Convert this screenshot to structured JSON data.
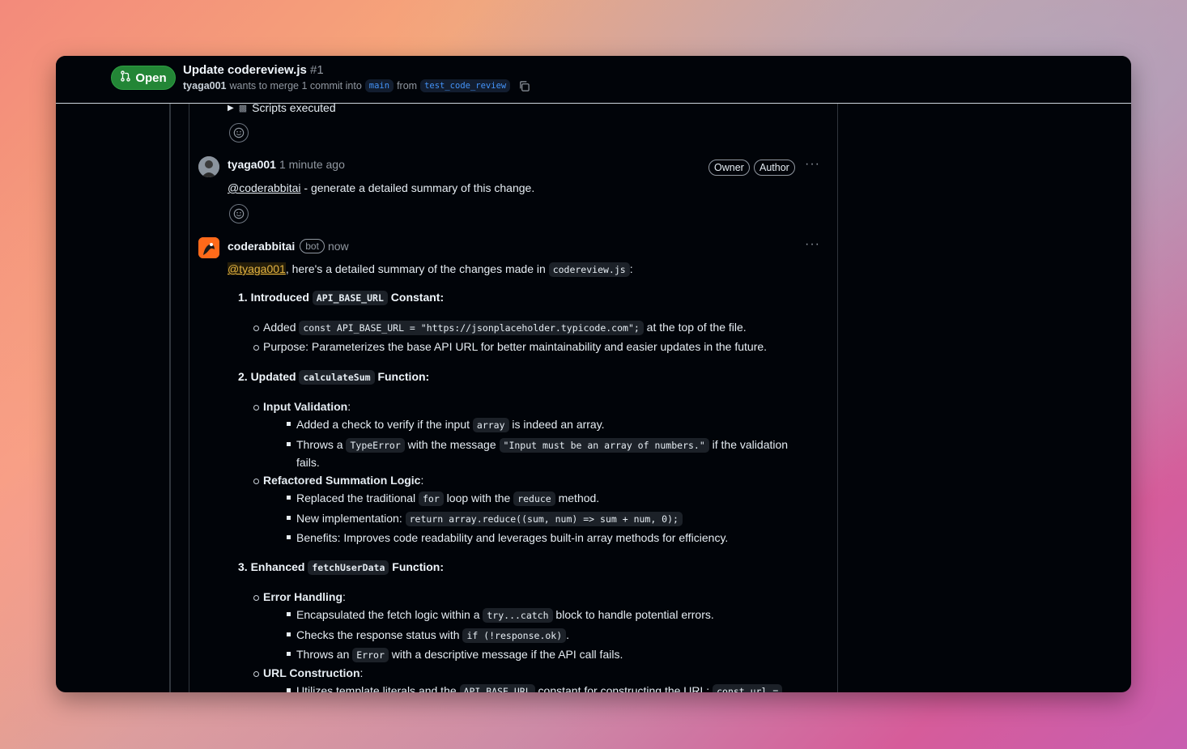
{
  "pr": {
    "status": "Open",
    "title": "Update codereview.js",
    "number": "#1",
    "author": "tyaga001",
    "merge_text": "wants to merge 1 commit into",
    "base_branch": "main",
    "from_text": "from",
    "head_branch": "test_code_review"
  },
  "details": {
    "label": "Scripts executed"
  },
  "comment1": {
    "author": "tyaga001",
    "time": "1 minute ago",
    "badge_owner": "Owner",
    "badge_author": "Author",
    "mention": "@coderabbitai",
    "text": " - generate a detailed summary of this change."
  },
  "comment2": {
    "author": "coderabbitai",
    "bot_label": "bot",
    "time": "now",
    "mention": "@tyaga001",
    "intro": ", here's a detailed summary of the changes made in ",
    "file": "codereview.js",
    "intro_end": ":"
  },
  "summary": {
    "s1": {
      "pre": "1. Introduced ",
      "code": "API_BASE_URL",
      "post": " Constant:"
    },
    "s1_added_pre": "Added ",
    "s1_added_code": "const API_BASE_URL = \"https://jsonplaceholder.typicode.com\";",
    "s1_added_post": " at the top of the file.",
    "s1_purpose": "Purpose: Parameterizes the base API URL for better maintainability and easier updates in the future.",
    "s2": {
      "pre": "2. Updated ",
      "code": "calculateSum",
      "post": " Function:"
    },
    "s2_iv": "Input Validation",
    "s2_iv_1_pre": "Added a check to verify if the input ",
    "s2_iv_1_code": "array",
    "s2_iv_1_post": " is indeed an array.",
    "s2_iv_2_pre": "Throws a ",
    "s2_iv_2_code1": "TypeError",
    "s2_iv_2_mid": " with the message ",
    "s2_iv_2_code2": "\"Input must be an array of numbers.\"",
    "s2_iv_2_post": " if the validation",
    "s2_iv_2_wrap": "fails.",
    "s2_rs": "Refactored Summation Logic",
    "s2_rs_1_pre": "Replaced the traditional ",
    "s2_rs_1_code1": "for",
    "s2_rs_1_mid": " loop with the ",
    "s2_rs_1_code2": "reduce",
    "s2_rs_1_post": " method.",
    "s2_rs_2_pre": "New implementation: ",
    "s2_rs_2_code": "return array.reduce((sum, num) => sum + num, 0);",
    "s2_rs_3": "Benefits: Improves code readability and leverages built-in array methods for efficiency.",
    "s3": {
      "pre": "3. Enhanced ",
      "code": "fetchUserData",
      "post": " Function:"
    },
    "s3_eh": "Error Handling",
    "s3_eh_1_pre": "Encapsulated the fetch logic within a ",
    "s3_eh_1_code": "try...catch",
    "s3_eh_1_post": " block to handle potential errors.",
    "s3_eh_2_pre": "Checks the response status with ",
    "s3_eh_2_code": "if (!response.ok)",
    "s3_eh_2_post": ".",
    "s3_eh_3_pre": "Throws an ",
    "s3_eh_3_code": "Error",
    "s3_eh_3_post": " with a descriptive message if the API call fails.",
    "s3_url": "URL Construction",
    "s3_url_1_pre": "Utilizes template literals and the ",
    "s3_url_1_code": "API_BASE_URL",
    "s3_url_1_post": " constant for constructing the URL: ",
    "s3_url_1_code2": "const url ="
  },
  "colon": ":"
}
